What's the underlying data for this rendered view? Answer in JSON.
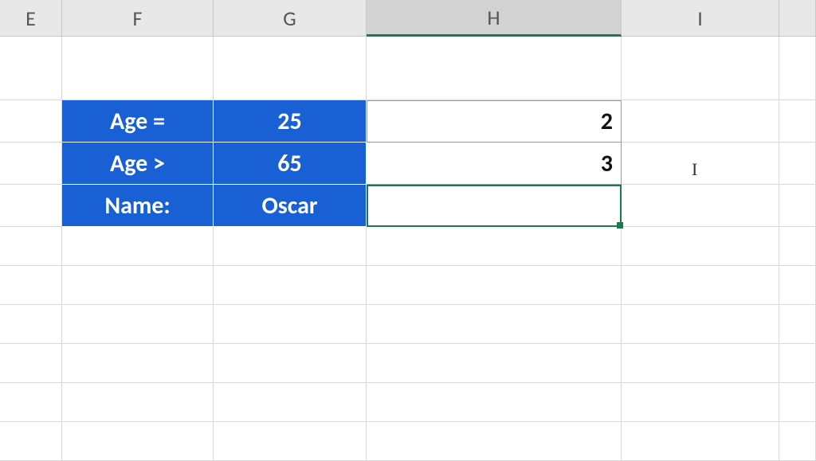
{
  "columns": {
    "E": "E",
    "F": "F",
    "G": "G",
    "H": "H",
    "I": "I"
  },
  "rows": {
    "r1": {
      "F": "Age =",
      "G": "25",
      "H": "2"
    },
    "r2": {
      "F": "Age >",
      "G": "65",
      "H": "3"
    },
    "r3": {
      "F": "Name:",
      "G": "Oscar",
      "H": ""
    }
  },
  "selected_column": "H",
  "active_cell": "H5"
}
